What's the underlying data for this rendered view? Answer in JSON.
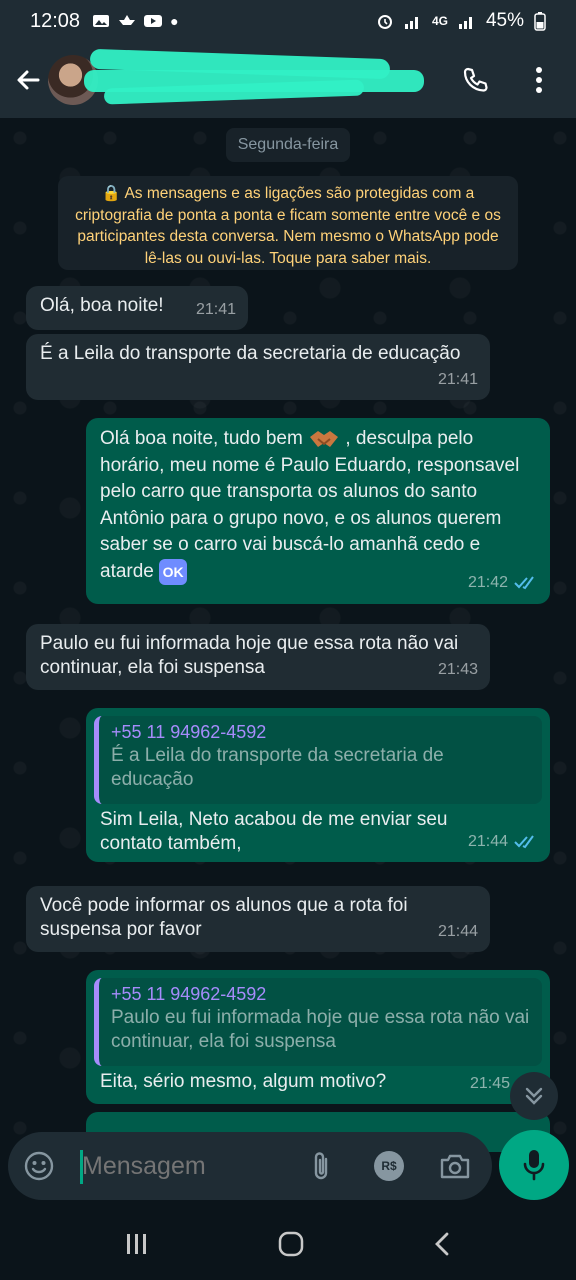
{
  "status": {
    "time": "12:08",
    "network": "4G",
    "battery": "45%"
  },
  "header": {
    "back_icon": "back-arrow-icon",
    "video_icon": "video-call-icon",
    "call_icon": "phone-icon",
    "menu_icon": "more-vert-icon"
  },
  "chat": {
    "date_chip": "Segunda-feira",
    "encryption_notice": "🔒 As mensagens e as ligações são protegidas com a criptografia de ponta a ponta e ficam somente entre você e os participantes desta conversa. Nem mesmo o WhatsApp pode lê-las ou ouvi-las. Toque para saber mais.",
    "messages": [
      {
        "dir": "in",
        "text": "Olá, boa noite!",
        "time": "21:41"
      },
      {
        "dir": "in",
        "text": "É a Leila do transporte da secretaria de educação",
        "time": "21:41"
      },
      {
        "dir": "out",
        "text_a": "Olá boa noite, tudo bem",
        "text_b": ", desculpa pelo horário, meu nome é Paulo Eduardo, responsavel pelo carro que transporta os alunos do santo Antônio para o grupo novo, e os alunos querem saber se o carro vai buscá-lo amanhã cedo e atarde",
        "emoji_ok": "OK",
        "time": "21:42"
      },
      {
        "dir": "in",
        "text": "Paulo eu fui informada hoje que essa rota não vai continuar,  ela foi suspensa",
        "time": "21:43"
      },
      {
        "dir": "out",
        "quote_name": "+55 11 94962-4592",
        "quote_text": "É a Leila do transporte da secretaria de educação",
        "text": "Sim Leila, Neto acabou de me enviar seu contato também,",
        "time": "21:44"
      },
      {
        "dir": "in",
        "text": "Você pode informar os alunos que a rota foi suspensa por favor",
        "time": "21:44"
      },
      {
        "dir": "out",
        "quote_name": "+55 11 94962-4592",
        "quote_text": "Paulo eu fui informada hoje que essa rota não vai continuar,  ela foi suspensa",
        "text": "Eita, sério mesmo, algum motivo?",
        "time": "21:45"
      }
    ]
  },
  "composer": {
    "placeholder": "Mensagem",
    "currency_label": "R$"
  },
  "colors": {
    "accent": "#00a884",
    "outgoing": "#005c4b",
    "incoming": "#202c33",
    "quote_name": "#a68cfb"
  }
}
